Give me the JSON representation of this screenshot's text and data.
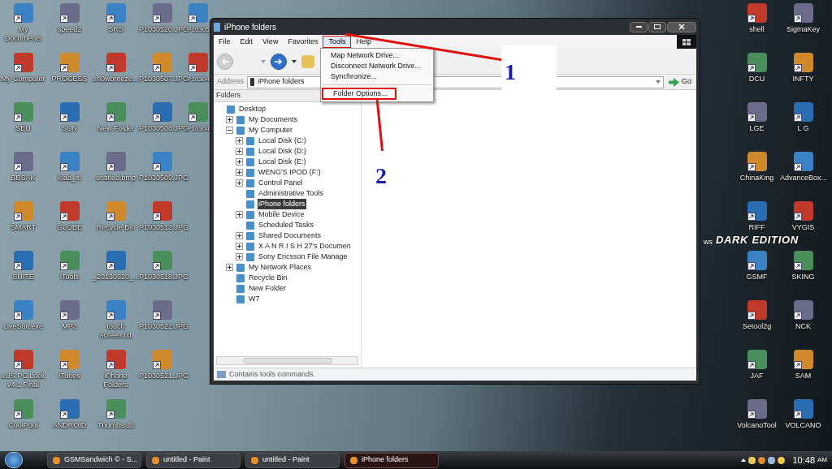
{
  "desktop": {
    "left_columns": [
      [
        "My Documents",
        "My Computer",
        "SEU",
        "BBSAK",
        "SMART",
        "SUITE",
        "LiveSuit.exe",
        "xUS PC Lock v4.1 Final",
        "CoolPool"
      ],
      [
        "speed2",
        "PROCESS",
        "SUN",
        "load_it!",
        "GLOBE",
        "iTools",
        "MP3",
        "iTunes",
        "ANDROID"
      ],
      [
        "SRS",
        "sn0wbreeze...",
        "New Folder",
        "untitled.bmp",
        "Recycle Bin",
        "_20130520_...",
        "touch screen.txt",
        "iPhone Folders",
        "Thumbs.db"
      ],
      [
        "P1030520.JPG",
        "P1030507.JPG",
        "P1030508.JPG",
        "P1030509.JPG",
        "P1030512.JPG",
        "P1030518.JPG",
        "P1030522.JPG",
        "P1030521.JPG"
      ],
      [
        "P10305",
        "P10304",
        "P10304"
      ]
    ],
    "right_columns": [
      [
        "shell",
        "DCU",
        "LGE",
        "ChinaKing",
        "RIFF",
        "GSMF",
        "Setool2g",
        "JAF",
        "VolcanoTool"
      ],
      [
        "SigmaKey",
        "INFTY",
        "L G",
        "AdvanceBox...",
        "VYGIS",
        "SKING",
        "NCK",
        "SAM",
        "VOLCANO"
      ]
    ],
    "wallpaper_text": [
      "ws",
      "DARK EDITION"
    ]
  },
  "window": {
    "title": "iPhone folders",
    "menu": [
      {
        "label": "File",
        "selected": false
      },
      {
        "label": "Edit",
        "selected": false
      },
      {
        "label": "View",
        "selected": false
      },
      {
        "label": "Favorites",
        "selected": false
      },
      {
        "label": "Tools",
        "selected": true
      },
      {
        "label": "Help",
        "selected": false
      }
    ],
    "dropdown": [
      {
        "kind": "item",
        "label": "Map Network Drive..."
      },
      {
        "kind": "item",
        "label": "Disconnect Network Drive..."
      },
      {
        "kind": "item",
        "label": "Synchronize..."
      },
      {
        "kind": "separator"
      },
      {
        "kind": "item",
        "label": "Folder Options..."
      }
    ],
    "address": {
      "label": "Address",
      "value": "iPhone folders",
      "go": "Go"
    },
    "folders_title": "Folders",
    "tree": [
      {
        "label": "Desktop",
        "selected": false,
        "children": [
          {
            "label": "My Documents",
            "expanded": false,
            "selected": false
          },
          {
            "label": "My Computer",
            "expanded": true,
            "selected": false,
            "children": [
              {
                "label": "Local Disk (C:)",
                "expanded": false,
                "selected": false
              },
              {
                "label": "Local Disk (D:)",
                "expanded": false,
                "selected": false
              },
              {
                "label": "Local Disk (E:)",
                "expanded": false,
                "selected": false
              },
              {
                "label": "WENG'S IPOD (F:)",
                "expanded": false,
                "selected": false
              },
              {
                "label": "Control Panel",
                "expanded": false,
                "selected": false
              },
              {
                "label": "Administrative Tools",
                "selected": false
              },
              {
                "label": "iPhone folders",
                "selected": true
              },
              {
                "label": "Mobile Device",
                "expanded": false,
                "selected": false
              },
              {
                "label": "Scheduled Tasks",
                "selected": false
              },
              {
                "label": "Shared Documents",
                "expanded": false,
                "selected": false
              },
              {
                "label": "X A N R I S H 27's Documen",
                "expanded": false,
                "selected": false
              },
              {
                "label": "Sony Ericsson File Manage",
                "expanded": false,
                "selected": false
              }
            ]
          },
          {
            "label": "My Network Places",
            "expanded": false,
            "selected": false
          },
          {
            "label": "Recycle Bin",
            "selected": false
          },
          {
            "label": "New Folder",
            "selected": false
          },
          {
            "label": "W7",
            "selected": false
          }
        ]
      }
    ],
    "status": "Contains tools commands."
  },
  "annotations": [
    "1",
    "2"
  ],
  "taskbar": {
    "items": [
      {
        "label": "GSMSandwich © - S...",
        "selected": false
      },
      {
        "label": "untitled - Paint",
        "selected": false
      },
      {
        "label": "untitled - Paint",
        "selected": false
      },
      {
        "label": "iPhone folders",
        "selected": true
      }
    ],
    "clock": "10:48",
    "ampm": "AM"
  }
}
